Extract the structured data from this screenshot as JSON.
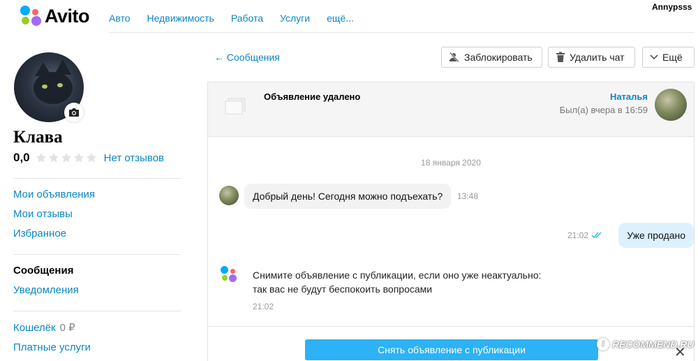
{
  "header": {
    "logo_text": "Avito",
    "nav": [
      "Авто",
      "Недвижимость",
      "Работа",
      "Услуги",
      "ещё..."
    ],
    "username": "Annypsss"
  },
  "profile": {
    "name": "Клава",
    "rating": "0,0",
    "stars_filled": 0,
    "stars_total": 5,
    "reviews_link": "Нет отзывов"
  },
  "sidebar": {
    "group1": [
      "Мои объявления",
      "Мои отзывы",
      "Избранное"
    ],
    "group2_active": "Сообщения",
    "group2": [
      "Уведомления"
    ],
    "wallet_label": "Кошелёк",
    "wallet_amount": "0 ₽",
    "paid_services": "Платные услуги"
  },
  "chat_toolbar": {
    "back": "← Сообщения",
    "block": "Заблокировать",
    "delete": "Удалить чат",
    "more": "Ещё"
  },
  "chat": {
    "ad_status": "Объявление удалено",
    "partner_name": "Наталья",
    "partner_seen": "Был(а) вчера в 16:59",
    "date": "18 января 2020",
    "messages": [
      {
        "text": "Добрый день! Сегодня можно подъехать?",
        "time": "13:48"
      },
      {
        "text": "Уже продано",
        "time": "21:02"
      }
    ],
    "system": {
      "line1": "Снимите объявление с публикации, если оно уже неактуально:",
      "line2": "так вас не будут беспокоить вопросами",
      "time": "21:02"
    },
    "action_button": "Снять объявление с публикации"
  },
  "watermark": "RECOMMEND.RU",
  "colors": {
    "link": "#0a86c4",
    "accent_button": "#2cb2f5",
    "outgoing_bubble": "#dcf1fd",
    "incoming_bubble": "#f2f2f2",
    "logo_dots": [
      "#00aaff",
      "#97cf26",
      "#ff6163",
      "#a169f7"
    ]
  }
}
